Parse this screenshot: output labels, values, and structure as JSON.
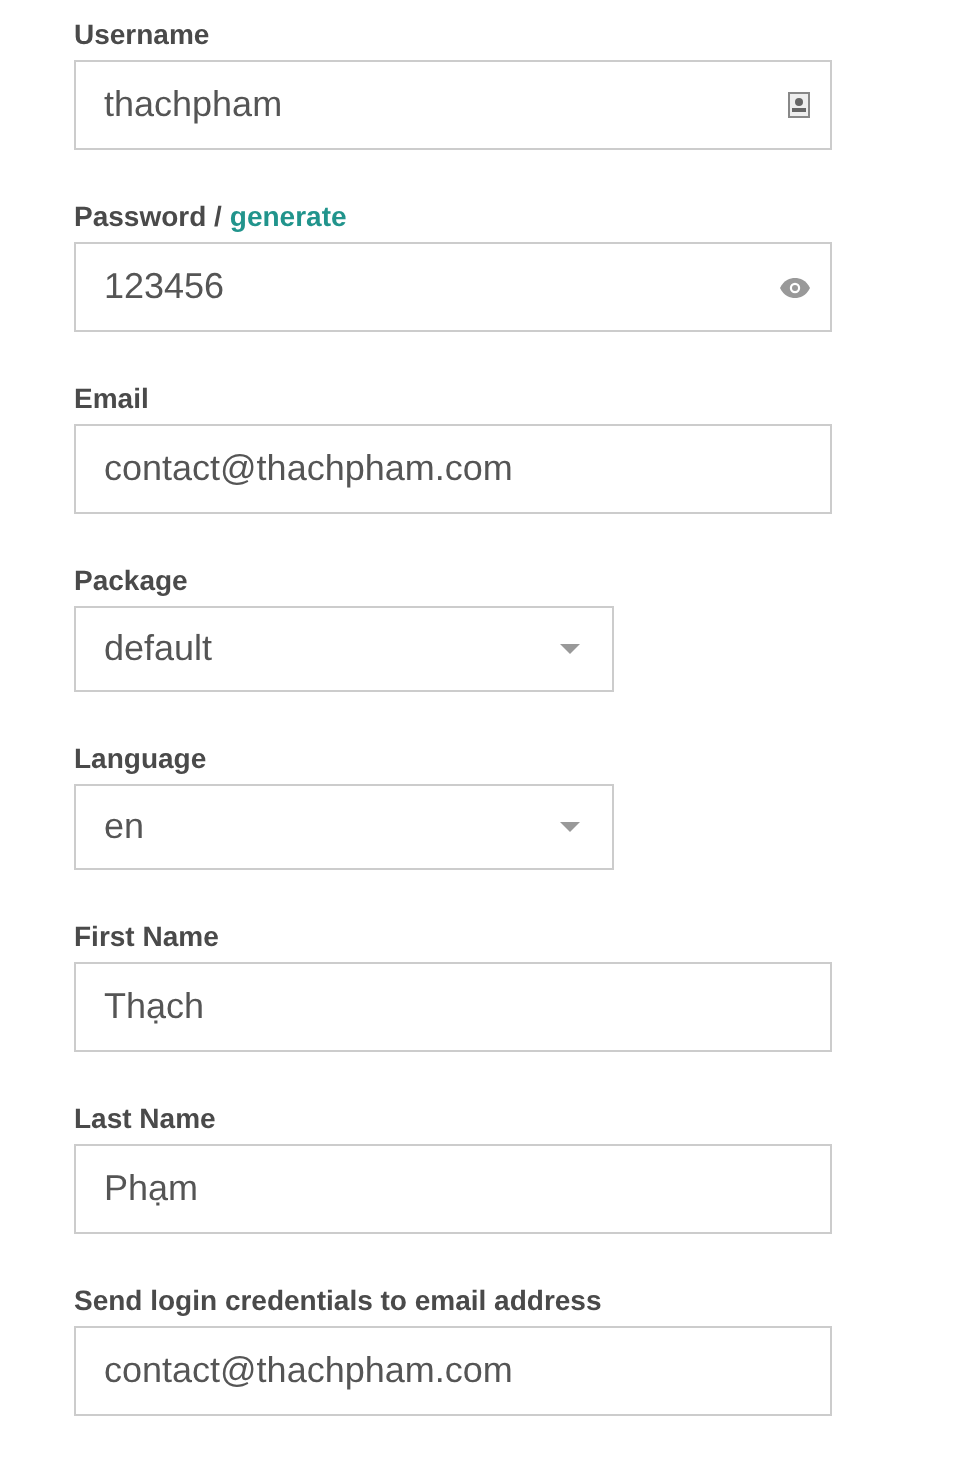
{
  "fields": [
    {
      "label": "Username",
      "kind": "username",
      "value": "thachpham"
    },
    {
      "label": "Password /",
      "link": "generate",
      "kind": "password",
      "value": "123456"
    },
    {
      "label": "Email",
      "kind": "text",
      "value": "contact@thachpham.com"
    },
    {
      "label": "Package",
      "kind": "select",
      "value": "default"
    },
    {
      "label": "Language",
      "kind": "select",
      "value": "en"
    },
    {
      "label": "First Name",
      "kind": "text",
      "value": "Thạch"
    },
    {
      "label": "Last Name",
      "kind": "text",
      "value": "Phạm"
    },
    {
      "label": "Send login credentials to email address",
      "kind": "text",
      "value": "contact@thachpham.com"
    }
  ]
}
